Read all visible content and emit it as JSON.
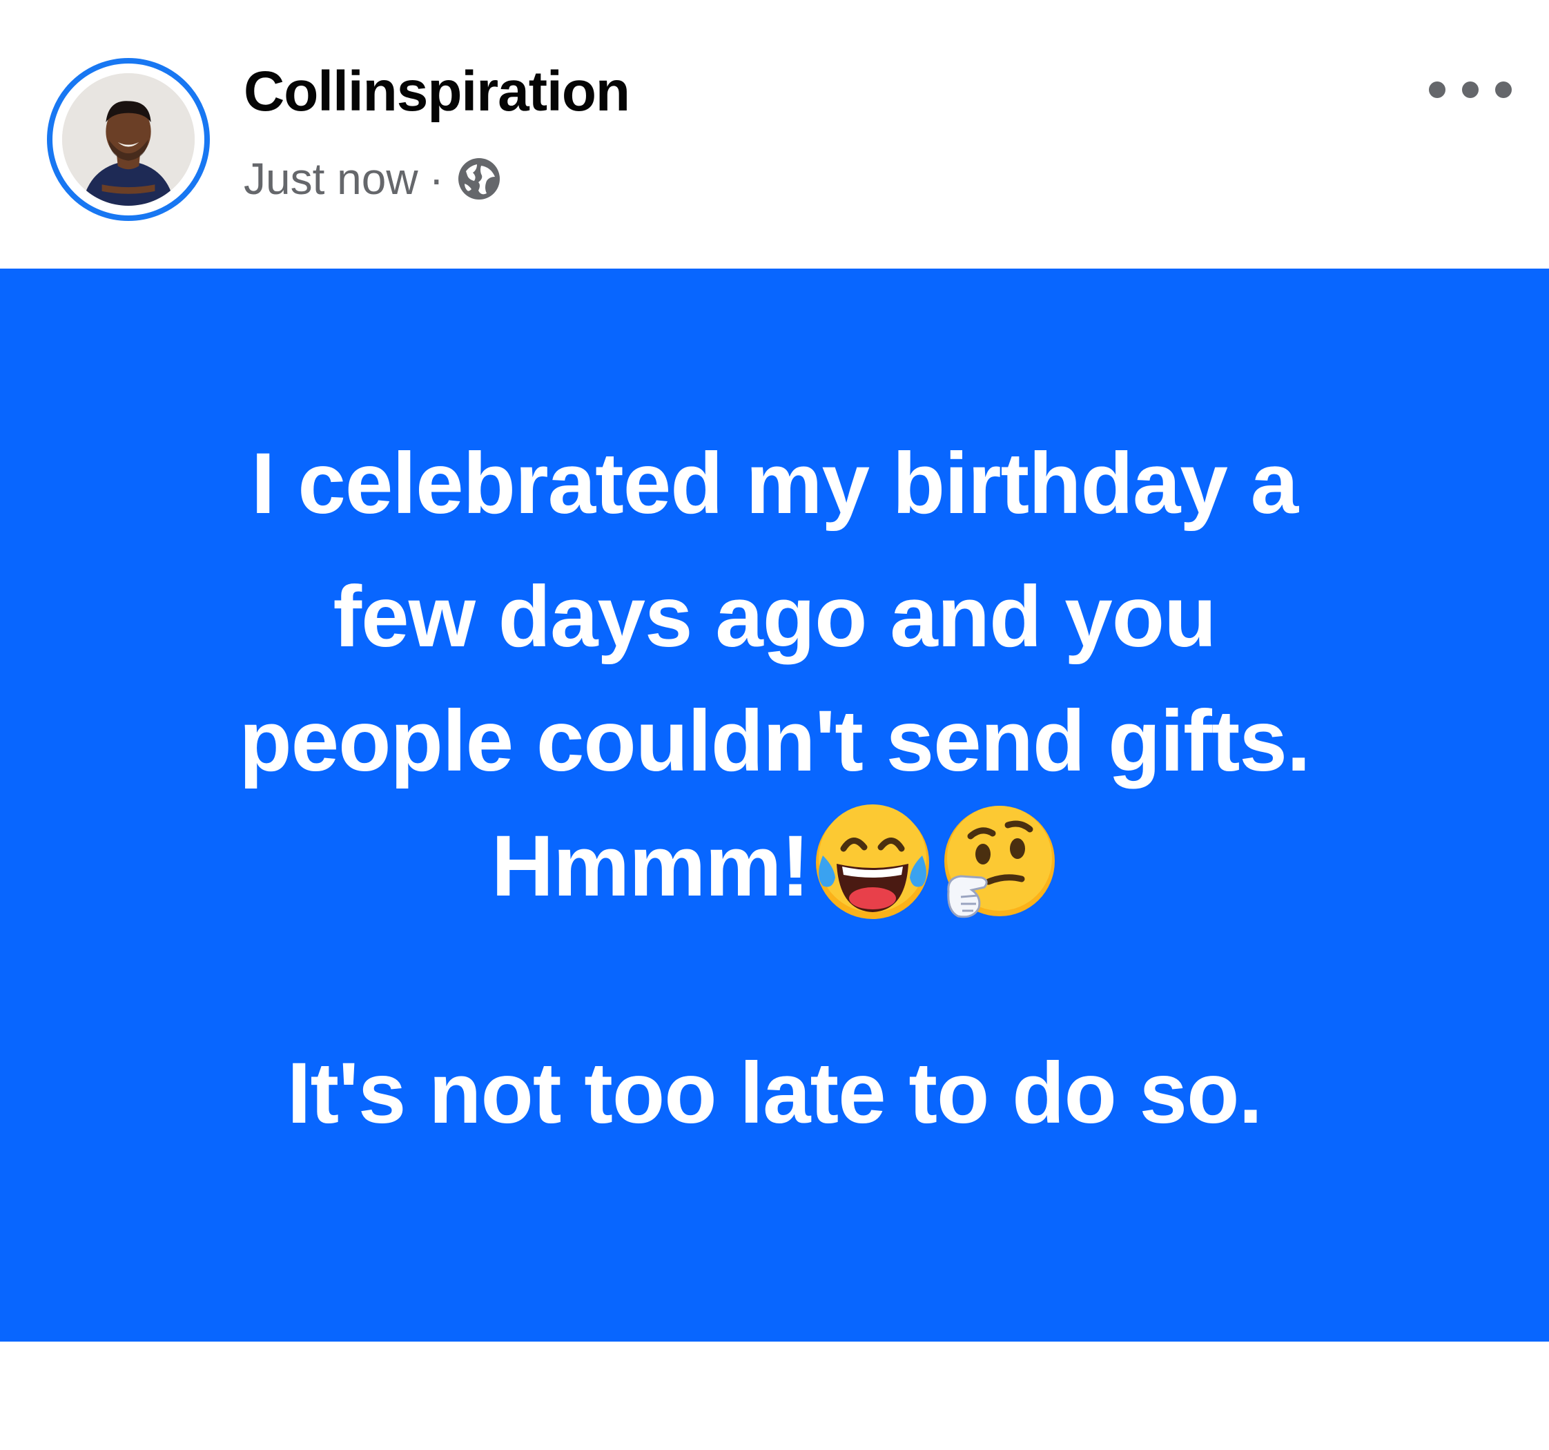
{
  "post": {
    "author": "Collinspiration",
    "time": "Just now",
    "separator": "·",
    "audience_icon": "globe-icon",
    "more_icon": "more-options-icon"
  },
  "content": {
    "background_color": "#0866ff",
    "lines": [
      "I celebrated my birthday a",
      "few days ago and you",
      "people couldn't send gifts.",
      "Hmmm!",
      "It's not too late to do so."
    ],
    "emojis": [
      "face-with-tears-of-joy-emoji",
      "thinking-face-emoji"
    ]
  }
}
